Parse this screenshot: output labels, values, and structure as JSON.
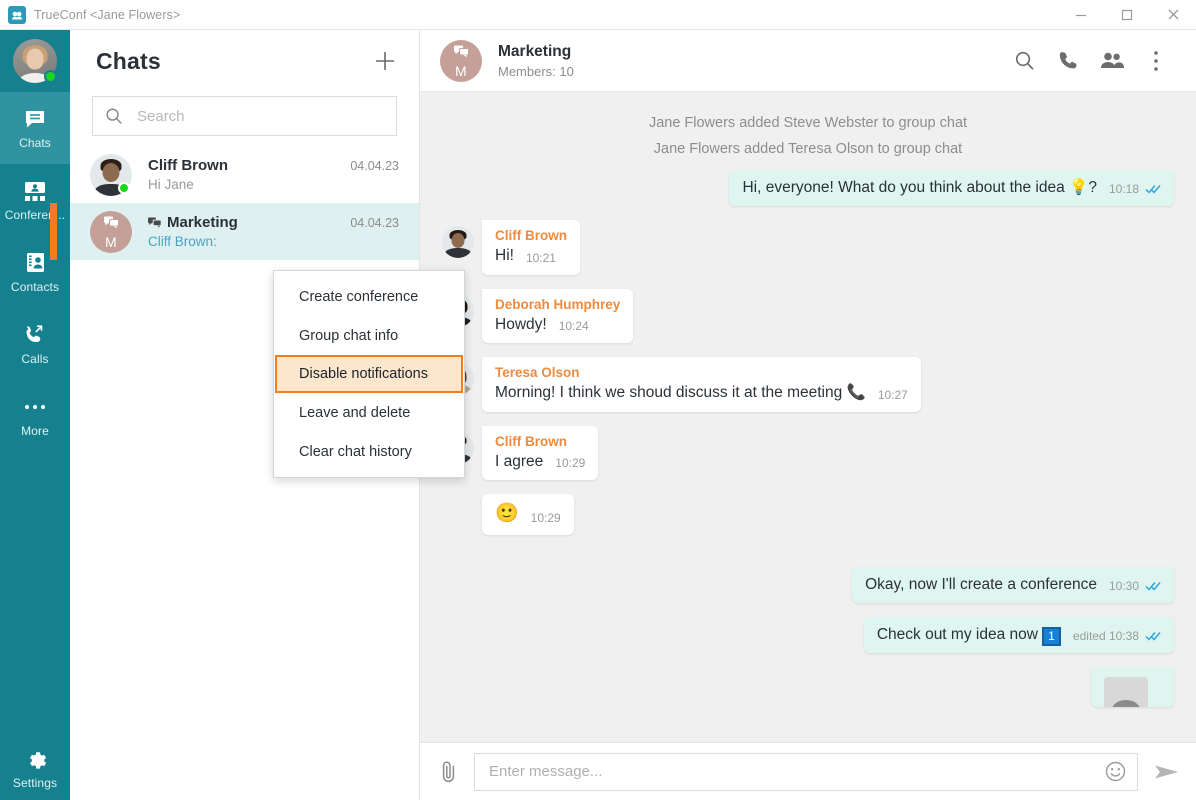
{
  "window": {
    "app_title": "TrueConf <Jane Flowers>",
    "logo_icon": "trueconf-logo-icon",
    "minimize_label": "Minimize",
    "maximize_label": "Maximize",
    "close_label": "Close"
  },
  "rail": {
    "user_status": "online",
    "items": [
      {
        "label": "Chats",
        "icon": "chat-bubble-icon",
        "active": true
      },
      {
        "label": "Conferen...",
        "icon": "conference-icon",
        "active": false
      },
      {
        "label": "Contacts",
        "icon": "contacts-card-icon",
        "active": false
      },
      {
        "label": "Calls",
        "icon": "phone-arrows-icon",
        "active": false
      },
      {
        "label": "More",
        "icon": "ellipsis-icon",
        "active": false
      }
    ],
    "settings": {
      "label": "Settings",
      "icon": "gear-icon"
    }
  },
  "chat_list": {
    "title": "Chats",
    "add_icon": "plus-icon",
    "search": {
      "placeholder": "Search",
      "value": "",
      "icon": "search-icon"
    },
    "rows": [
      {
        "name": "Cliff Brown",
        "date": "04.04.23",
        "preview": "Hi Jane",
        "avatar_type": "photo-male",
        "online": true,
        "selected": false,
        "is_group": false
      },
      {
        "name": "Marketing",
        "date": "04.04.23",
        "preview": "Cliff Brown:",
        "avatar_type": "group-initial",
        "avatar_initial": "M",
        "online": false,
        "selected": true,
        "is_group": true,
        "group_icon": "group-chat-icon"
      }
    ]
  },
  "context_menu": {
    "items": [
      {
        "label": "Create conference",
        "highlighted": false
      },
      {
        "label": "Group chat info",
        "highlighted": false
      },
      {
        "label": "Disable notifications",
        "highlighted": true
      },
      {
        "label": "Leave and delete",
        "highlighted": false
      },
      {
        "label": "Clear chat history",
        "highlighted": false
      }
    ]
  },
  "chat_header": {
    "title": "Marketing",
    "subtitle": "Members: 10",
    "avatar_initial": "M",
    "actions": [
      {
        "name": "search-icon",
        "label": "Search in chat"
      },
      {
        "name": "phone-icon",
        "label": "Call"
      },
      {
        "name": "people-icon",
        "label": "Participants"
      },
      {
        "name": "more-vertical-icon",
        "label": "More options"
      }
    ]
  },
  "messages": [
    {
      "kind": "system",
      "text": "Jane Flowers added Steve Webster to group chat"
    },
    {
      "kind": "system",
      "text": "Jane Flowers added Teresa Olson to group chat"
    },
    {
      "kind": "outgoing",
      "text": "Hi, everyone! What do you think about the idea 💡?",
      "time": "10:18",
      "status": "read",
      "status_icon": "double-check-icon"
    },
    {
      "kind": "incoming",
      "sender": "Cliff Brown",
      "text": "Hi!",
      "time": "10:21",
      "avatar_type": "photo-male"
    },
    {
      "kind": "incoming",
      "sender": "Deborah Humphrey",
      "text": "Howdy!",
      "time": "10:24",
      "avatar_type": "photo-female-dark"
    },
    {
      "kind": "incoming",
      "sender": "Teresa Olson",
      "text": "Morning! I think we shoud discuss it at the meeting 📞",
      "time": "10:27",
      "avatar_type": "photo-female-light"
    },
    {
      "kind": "incoming",
      "sender": "Cliff Brown",
      "text": "I agree",
      "time": "10:29",
      "avatar_type": "photo-male"
    },
    {
      "kind": "incoming-emoji",
      "text": "🙂",
      "time": "10:29"
    },
    {
      "kind": "outgoing",
      "text": "Okay, now I'll create a conference",
      "time": "10:30",
      "status": "read",
      "status_icon": "double-check-icon"
    },
    {
      "kind": "outgoing-link",
      "text": "Check out my idea now",
      "badge": "1",
      "time": "edited 10:38",
      "status": "read",
      "status_icon": "double-check-icon"
    },
    {
      "kind": "outgoing-preview",
      "text": " ",
      "thumb_icon": "image-thumbnail-icon"
    }
  ],
  "input_bar": {
    "attach_icon": "paperclip-icon",
    "placeholder": "Enter message...",
    "value": "",
    "emoji_icon": "smiley-icon",
    "send_icon": "send-arrow-icon"
  },
  "colors": {
    "rail_bg": "#15818f",
    "rail_active": "#2f93a0",
    "accent_orange": "#f07d20",
    "sender_orange": "#f08a3c",
    "outgoing_bubble": "#dff5f0",
    "selected_row": "#dff0f0",
    "chat_bg": "#f0f0f0",
    "tick_blue": "#2fa8d8"
  }
}
